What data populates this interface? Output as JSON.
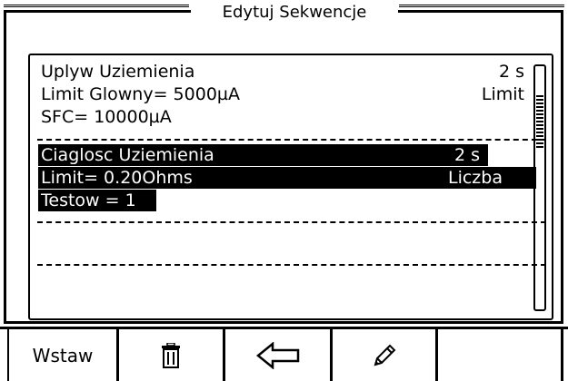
{
  "window": {
    "title": "Edytuj Sekwencje"
  },
  "tests": [
    {
      "name": "Uplyw Uziemienia",
      "duration": "2 s",
      "line2_left": "Limit Glowny= 5000µA",
      "line2_right": "Limit",
      "line3_left": "SFC= 10000µA"
    },
    {
      "name": "Ciaglosc Uziemienia",
      "duration": "2 s",
      "line2_left": "Limit= 0.20Ohms",
      "line2_right": "Liczba",
      "line3_left": "Testow = 1"
    }
  ],
  "toolbar": {
    "insert_label": "Wstaw",
    "delete_icon": "trash-icon",
    "back_icon": "arrow-left-icon",
    "edit_icon": "pencil-icon"
  },
  "colors": {
    "foreground": "#000000",
    "background": "#ffffff"
  }
}
